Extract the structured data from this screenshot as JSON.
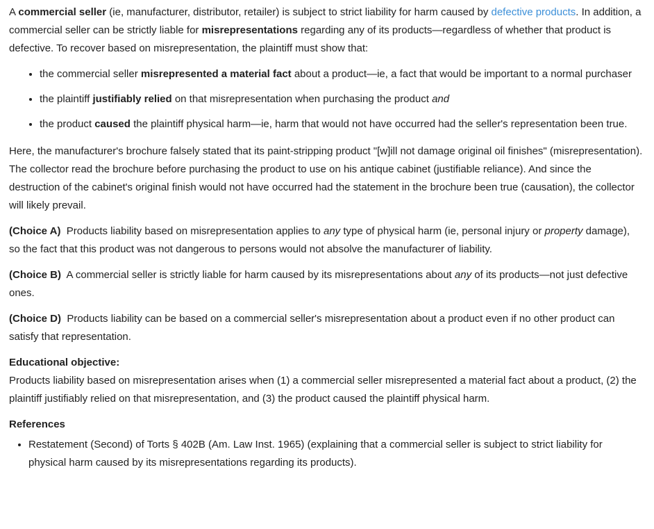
{
  "intro": {
    "s1": "A ",
    "b1": "commercial seller",
    "s2": " (ie, manufacturer, distributor, retailer) is subject to strict liability for harm caused by ",
    "link": "defective products",
    "s3": ".  In addition, a commercial seller can be strictly liable for ",
    "b2": "misrepresentations",
    "s4": " regarding any of its products—regardless of whether that product is defective.  To recover based on misrepresentation, the plaintiff must show that:"
  },
  "elements": [
    {
      "pre": "the commercial seller ",
      "bold": "misrepresented a material fact",
      "post": " about a product—ie, a fact that would be important to a normal purchaser"
    },
    {
      "pre": "the plaintiff ",
      "bold": "justifiably relied",
      "post": " on that misrepresentation when purchasing the product ",
      "italic": "and"
    },
    {
      "pre": "the product ",
      "bold": "caused",
      "post": " the plaintiff physical harm—ie, harm that would not have occurred had the seller's representation been true."
    }
  ],
  "application": "Here, the manufacturer's brochure falsely stated that its paint-stripping product \"[w]ill not damage original oil finishes\" (misrepresentation).  The collector read the brochure before purchasing the product to use on his antique cabinet (justifiable reliance).  And since the destruction of the cabinet's original finish would not have occurred had the statement in the brochure been true (causation), the collector will likely prevail.",
  "choices": [
    {
      "label": "(Choice A)",
      "t1": "  Products liability based on misrepresentation applies to ",
      "i1": "any",
      "t2": " type of physical harm (ie, personal injury or ",
      "i2": "property",
      "t3": " damage), so the fact that this product was not dangerous to persons would not absolve the manufacturer of liability."
    },
    {
      "label": "(Choice B)",
      "t1": "  A commercial seller is strictly liable for harm caused by its misrepresentations about ",
      "i1": "any",
      "t2": " of its products—not just defective ones."
    },
    {
      "label": "(Choice D)",
      "t1": "  Products liability can be based on a commercial seller's misrepresentation about a product even if no other product can satisfy that representation."
    }
  ],
  "objective": {
    "heading": "Educational objective:",
    "text": "Products liability based on misrepresentation arises when (1) a commercial seller misrepresented a material fact about a product, (2) the plaintiff justifiably relied on that misrepresentation, and (3) the product caused the plaintiff physical harm."
  },
  "references": {
    "heading": "References",
    "items": [
      "Restatement (Second) of Torts § 402B (Am. Law Inst. 1965) (explaining that a commercial seller is subject to strict liability for physical harm caused by its misrepresentations regarding its products)."
    ]
  },
  "colors": {
    "link": "#3c8fd8",
    "text": "#222222"
  }
}
